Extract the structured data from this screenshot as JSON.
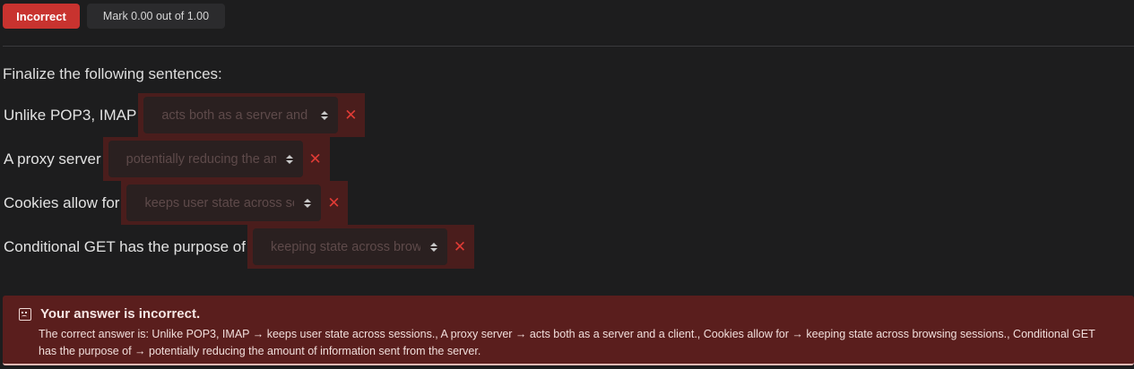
{
  "header": {
    "state": "Incorrect",
    "mark": "Mark 0.00 out of 1.00"
  },
  "question": {
    "prompt": "Finalize the following sentences:",
    "rows": [
      {
        "label": "Unlike POP3, IMAP",
        "selected": "acts both as a server and a client."
      },
      {
        "label": "A proxy server",
        "selected": "potentially reducing the amount of information sent from the server."
      },
      {
        "label": "Cookies allow for",
        "selected": "keeps user state across sessions."
      },
      {
        "label": "Conditional GET has the purpose of",
        "selected": "keeping state across browsing sessions."
      }
    ]
  },
  "feedback": {
    "title": "Your answer is incorrect.",
    "correct_answer": "The correct answer is: Unlike POP3, IMAP → keeps user state across sessions., A proxy server  → acts both as a server and a client., Cookies allow for  → keeping state across browsing sessions., Conditional GET has the purpose of  → potentially reducing the amount of information sent from the server."
  },
  "colors": {
    "incorrect_badge": "#c8332f",
    "feedback_bg": "#5a1e1d",
    "row_highlight": "#4a1d1c",
    "x_mark": "#e03b35"
  },
  "icons": {
    "wrong_mark": "close-icon",
    "feedback": "sad-face-icon",
    "select_caret": "up-down-caret-icon"
  }
}
